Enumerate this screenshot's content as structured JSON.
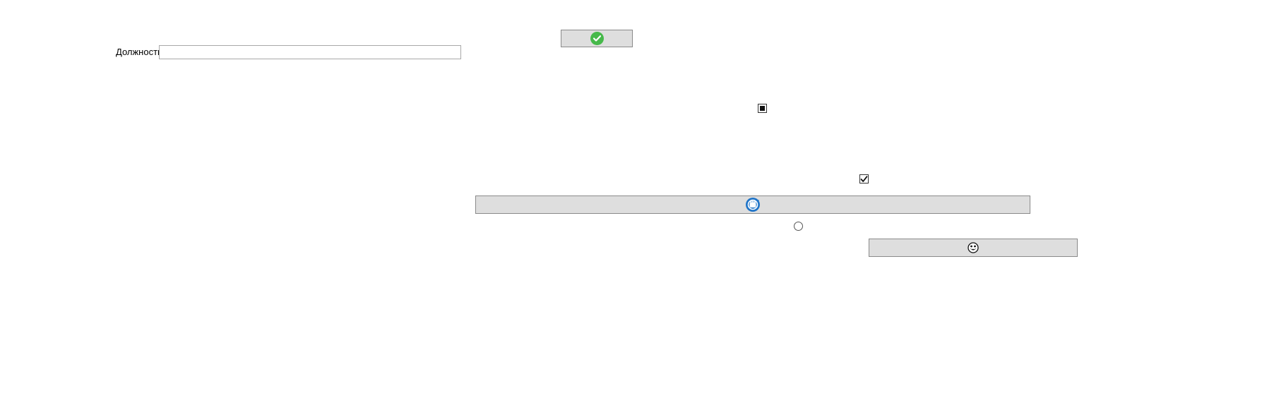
{
  "form": {
    "position_label": "Должность",
    "position_value": "",
    "position_placeholder": ""
  },
  "buttons": {
    "confirm_icon": "check-circle-icon",
    "wide_icon": "refresh-hand-icon",
    "emoji_icon": "grin-emoji-icon"
  },
  "controls": {
    "square_checkbox_state": "indeterminate",
    "checkbox_state": "checked",
    "radio_state": "unchecked"
  },
  "colors": {
    "button_bg": "#dedede",
    "confirm_green": "#46b94a",
    "refresh_blue": "#1f74c8"
  }
}
